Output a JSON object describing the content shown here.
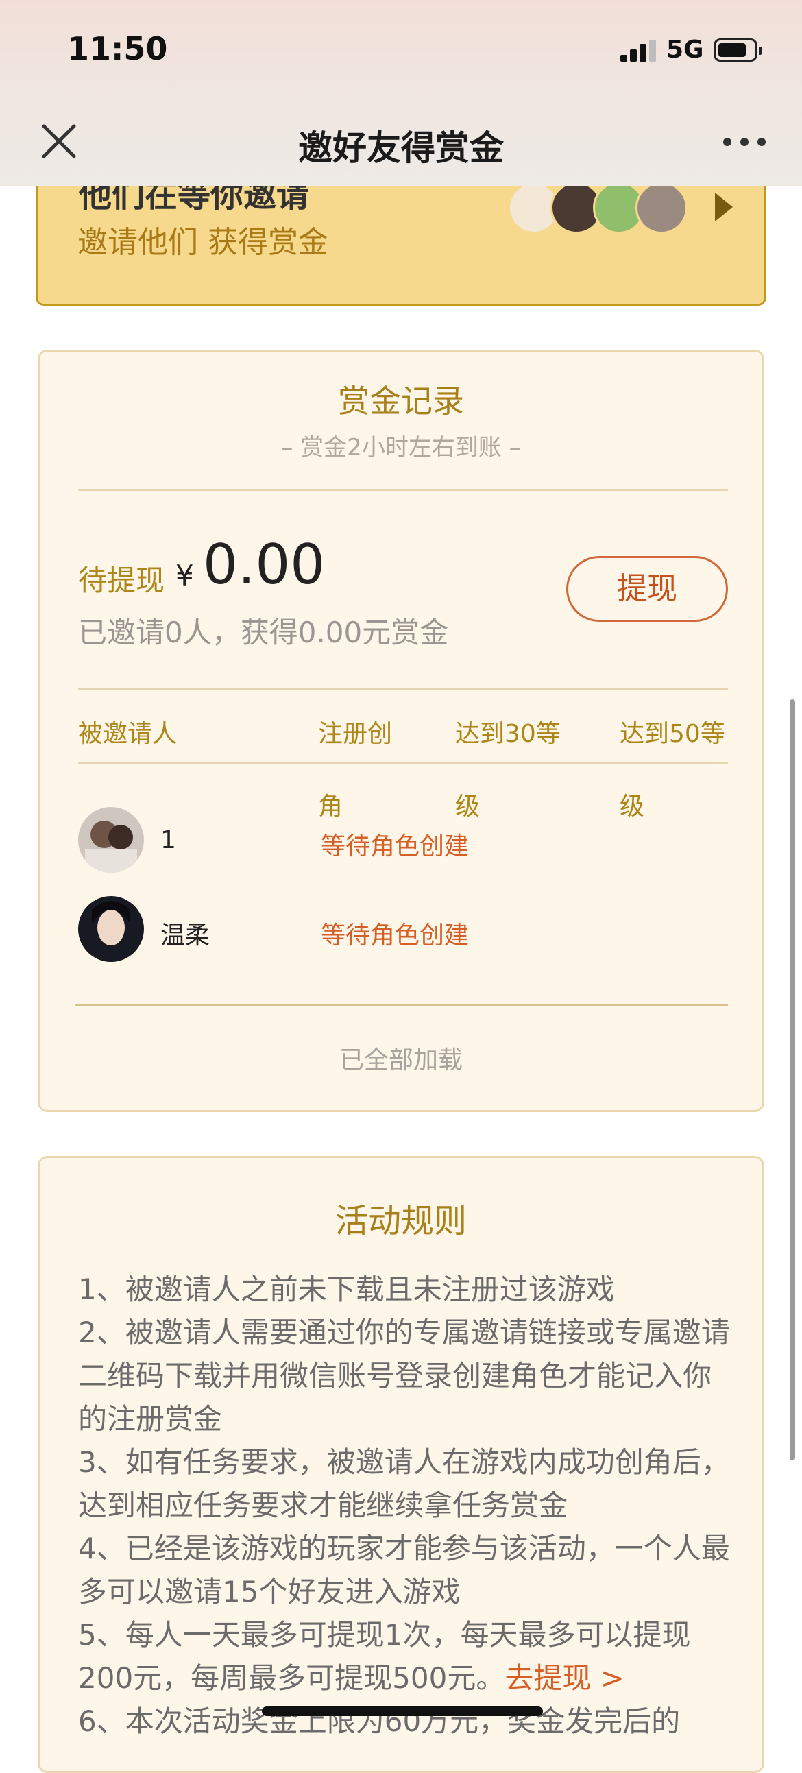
{
  "status_bar": {
    "time": "11:50",
    "network": "5G"
  },
  "nav": {
    "title": "邀好友得赏金",
    "close_icon": "close-icon",
    "more_icon": "more-dots-icon"
  },
  "banner": {
    "partial_title": "他们在等你邀请",
    "subtitle": "邀请他们 获得赏金",
    "avatar_colors": [
      "#f3e7d6",
      "#4a3a32",
      "#8fbf6a",
      "#9a8a80"
    ]
  },
  "bounty": {
    "title": "赏金记录",
    "subtitle": "– 赏金2小时左右到账 –",
    "pending_label": "待提现",
    "currency_symbol": "¥",
    "pending_amount": "0.00",
    "summary": "已邀请0人，获得0.00元赏金",
    "withdraw_label": "提现",
    "columns": {
      "invitee": "被邀请人",
      "register_line1": "注册创",
      "register_line2": "角",
      "level30_line1": "达到30等",
      "level30_line2": "级",
      "level50_line1": "达到50等",
      "level50_line2": "级"
    },
    "rows": [
      {
        "name": "1",
        "status": "等待角色创建"
      },
      {
        "name": "温柔",
        "status": "等待角色创建"
      }
    ],
    "loaded_text": "已全部加载"
  },
  "rules": {
    "title": "活动规则",
    "items": [
      "1、被邀请人之前未下载且未注册过该游戏",
      "2、被邀请人需要通过你的专属邀请链接或专属邀请二维码下载并用微信账号登录创建角色才能记入你的注册赏金",
      "3、如有任务要求，被邀请人在游戏内成功创角后，达到相应任务要求才能继续拿任务赏金",
      "4、已经是该游戏的玩家才能参与该活动，一个人最多可以邀请15个好友进入游戏",
      "5、每人一天最多可提现1次，每天最多可以提现200元，每周最多可提现500元。",
      "6、本次活动奖金上限为60万元，奖金发完后的"
    ],
    "withdraw_link": "去提现 >"
  },
  "colors": {
    "accent_gold": "#ad8617",
    "accent_orange": "#d65f25",
    "banner_bg": "#f6d98d",
    "card_bg": "#fff6ea"
  }
}
